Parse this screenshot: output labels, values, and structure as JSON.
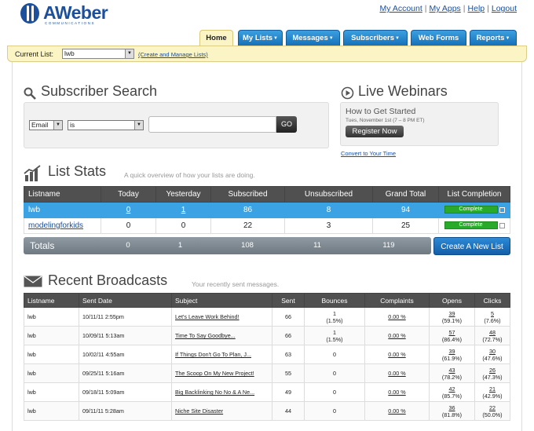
{
  "header": {
    "brand": "AWeber",
    "brand_sub": "COMMUNICATIONS",
    "top_links": [
      "My Account",
      "My Apps",
      "Help",
      "Logout"
    ]
  },
  "nav": {
    "tabs": [
      {
        "label": "Home",
        "active": true
      },
      {
        "label": "My Lists",
        "dropdown": true
      },
      {
        "label": "Messages",
        "dropdown": true
      },
      {
        "label": "Subscribers",
        "dropdown": true
      },
      {
        "label": "Web Forms",
        "dropdown": false
      },
      {
        "label": "Reports",
        "dropdown": true
      }
    ]
  },
  "list_bar": {
    "label": "Current List:",
    "selected": "lwb",
    "manage": "(Create and Manage Lists)"
  },
  "subscriber_search": {
    "title": "Subscriber Search",
    "field": "Email",
    "operator": "is",
    "value": "",
    "go": "GO"
  },
  "live_webinars": {
    "title": "Live Webinars",
    "event": "How to Get Started",
    "date": "Tues, November 1st (7 – 8 PM ET)",
    "register": "Register Now",
    "convert": "Convert to Your Time"
  },
  "list_stats": {
    "title": "List Stats",
    "subtitle": "A quick overview of how your lists are doing.",
    "columns": [
      "Listname",
      "Today",
      "Yesterday",
      "Subscribed",
      "Unsubscribed",
      "Grand Total",
      "List Completion"
    ],
    "rows": [
      {
        "name": "lwb",
        "today": "0",
        "yesterday": "1",
        "subscribed": "86",
        "unsubscribed": "8",
        "total": "94",
        "completion": "Complete"
      },
      {
        "name": "modelingforkids",
        "today": "0",
        "yesterday": "0",
        "subscribed": "22",
        "unsubscribed": "3",
        "total": "25",
        "completion": "Complete"
      }
    ],
    "totals": {
      "label": "Totals",
      "today": "0",
      "yesterday": "1",
      "subscribed": "108",
      "unsubscribed": "11",
      "total": "119"
    },
    "new_list": "Create A New List"
  },
  "recent_broadcasts": {
    "title": "Recent Broadcasts",
    "subtitle": "Your recently sent messages.",
    "columns": [
      "Listname",
      "Sent Date",
      "Subject",
      "Sent",
      "Bounces",
      "Complaints",
      "Opens",
      "Clicks"
    ],
    "rows": [
      {
        "list": "lwb",
        "date": "10/11/11 2:55pm",
        "subject": "Let's Leave Work Behind!",
        "sent": "66",
        "bounces": "1",
        "bounces_pct": "(1.5%)",
        "complaints": "0.00 %",
        "opens": "39",
        "opens_pct": "(59.1%)",
        "clicks": "5",
        "clicks_pct": "(7.6%)"
      },
      {
        "list": "lwb",
        "date": "10/09/11 5:13am",
        "subject": "Time To Say Goodbye...",
        "sent": "66",
        "bounces": "1",
        "bounces_pct": "(1.5%)",
        "complaints": "0.00 %",
        "opens": "57",
        "opens_pct": "(86.4%)",
        "clicks": "48",
        "clicks_pct": "(72.7%)"
      },
      {
        "list": "lwb",
        "date": "10/02/11 4:55am",
        "subject": "If Things Don't Go To Plan, J...",
        "sent": "63",
        "bounces": "0",
        "bounces_pct": "",
        "complaints": "0.00 %",
        "opens": "39",
        "opens_pct": "(61.9%)",
        "clicks": "30",
        "clicks_pct": "(47.6%)"
      },
      {
        "list": "lwb",
        "date": "09/25/11 5:16am",
        "subject": "The Scoop On My New Project!",
        "sent": "55",
        "bounces": "0",
        "bounces_pct": "",
        "complaints": "0.00 %",
        "opens": "43",
        "opens_pct": "(78.2%)",
        "clicks": "26",
        "clicks_pct": "(47.3%)"
      },
      {
        "list": "lwb",
        "date": "09/18/11 5:09am",
        "subject": "Big Backlinking No No & A Ne...",
        "sent": "49",
        "bounces": "0",
        "bounces_pct": "",
        "complaints": "0.00 %",
        "opens": "42",
        "opens_pct": "(85.7%)",
        "clicks": "21",
        "clicks_pct": "(42.9%)"
      },
      {
        "list": "lwb",
        "date": "09/11/11 5:28am",
        "subject": "Niche Site Disaster",
        "sent": "44",
        "bounces": "0",
        "bounces_pct": "",
        "complaints": "0.00 %",
        "opens": "36",
        "opens_pct": "(81.8%)",
        "clicks": "22",
        "clicks_pct": "(50.0%)"
      }
    ]
  },
  "colors": {
    "brand": "#1c4f9c",
    "tab_blue": "#1670b8",
    "selected_row": "#3ba3e3",
    "complete": "#2aaa2a",
    "list_bar": "#fbf4c4"
  }
}
